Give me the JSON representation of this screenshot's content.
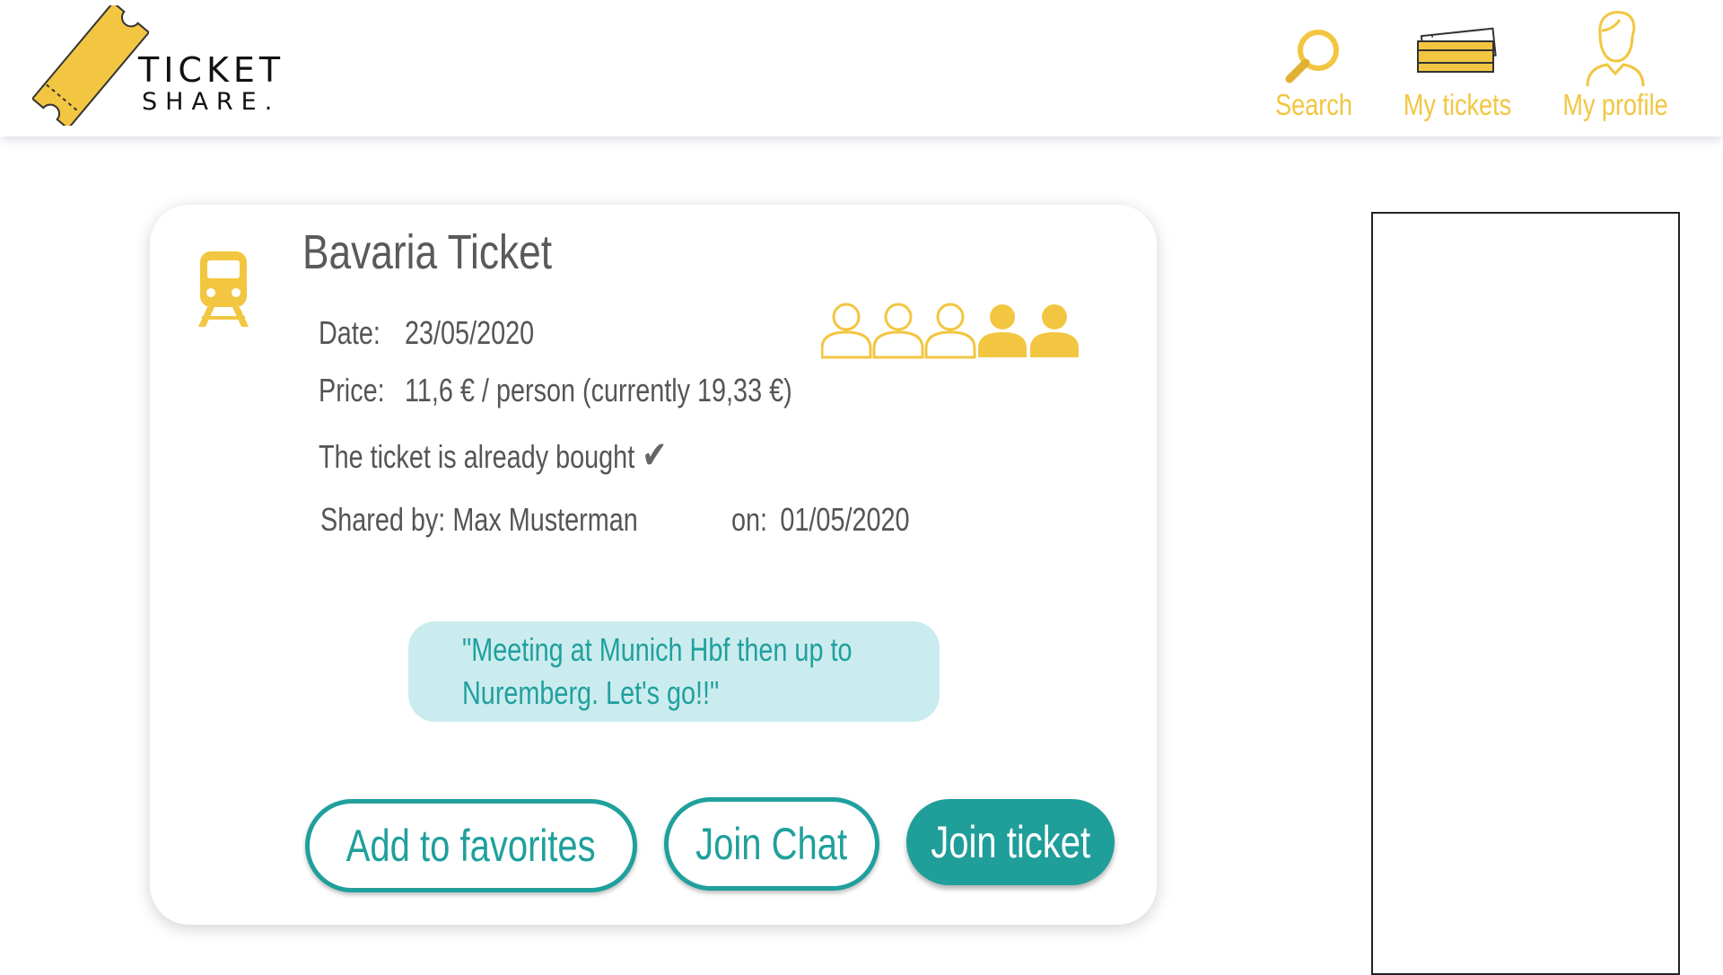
{
  "brand": {
    "line1": "TICKET",
    "line2": "SHARE."
  },
  "nav": {
    "search_label": "Search",
    "tickets_label": "My tickets",
    "profile_label": "My profile"
  },
  "colors": {
    "accent_yellow": "#F2C641",
    "teal": "#1FA09C",
    "quote_bg": "#CBECEE"
  },
  "ticket": {
    "title": "Bavaria Ticket",
    "icon": "train-icon",
    "participants": {
      "total": 5,
      "filled": 2
    },
    "date_label": "Date:",
    "date_value": "23/05/2020",
    "price_label": "Price:",
    "price_value": "11,6 € / person (currently 19,33 €)",
    "status_text": "The ticket is already bought",
    "status_icon": "✔",
    "shared_by_label": "Shared by:",
    "shared_by_name": "Max Musterman",
    "shared_on_label": "on:",
    "shared_on_value": "01/05/2020",
    "quote_line1": "\"Meeting at Munich Hbf  then up to",
    "quote_line2": "Nuremberg. Let's go!!\""
  },
  "actions": {
    "favorites_label": "Add to favorites",
    "chat_label": "Join Chat",
    "join_label": "Join ticket"
  }
}
